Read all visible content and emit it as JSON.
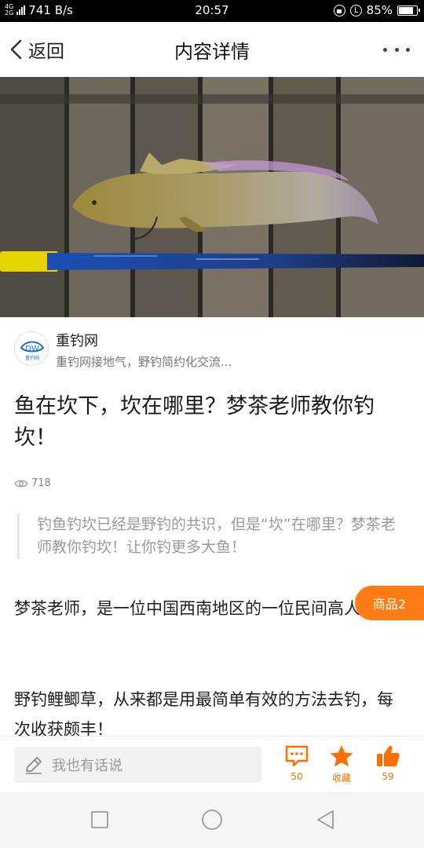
{
  "status_bar": {
    "network_top": "4G",
    "network_bottom": "2G",
    "speed": "741 B/s",
    "time": "20:57",
    "battery_percent": "85%",
    "battery_level": 0.85
  },
  "header": {
    "back_label": "返回",
    "title": "内容详情"
  },
  "hero": {
    "image_alt": "鱼与鱼竿"
  },
  "author": {
    "name": "重钓网",
    "description": "重钓网接地气，野钓简约化交流...",
    "avatar_text": "重钓网"
  },
  "article": {
    "title": "鱼在坎下，坎在哪里？梦茶老师教你钓坎！",
    "views": "718",
    "summary": "钓鱼钓坎已经是野钓的共识，但是“坎”在哪里？梦茶老师教你钓坎！让你钓更多大鱼！",
    "paragraphs": [
      "梦茶老师，是一位中国西南地区的一位民间高人。",
      "野钓鲤鲫草，从来都是用最简单有效的方法去钓，每次收获颇丰！"
    ]
  },
  "goods_badge": "商品2",
  "bottom_bar": {
    "comment_placeholder": "我也有话说",
    "comments_count": "50",
    "favorite_label": "收藏",
    "likes_count": "59",
    "accent_color": "#ff6f00"
  },
  "icons": {
    "back": "chevron-left-icon",
    "more": "more-dots-icon",
    "views": "eye-icon",
    "edit": "pencil-icon",
    "comment": "comment-bubble-icon",
    "favorite": "star-icon",
    "like": "thumbs-up-icon"
  }
}
